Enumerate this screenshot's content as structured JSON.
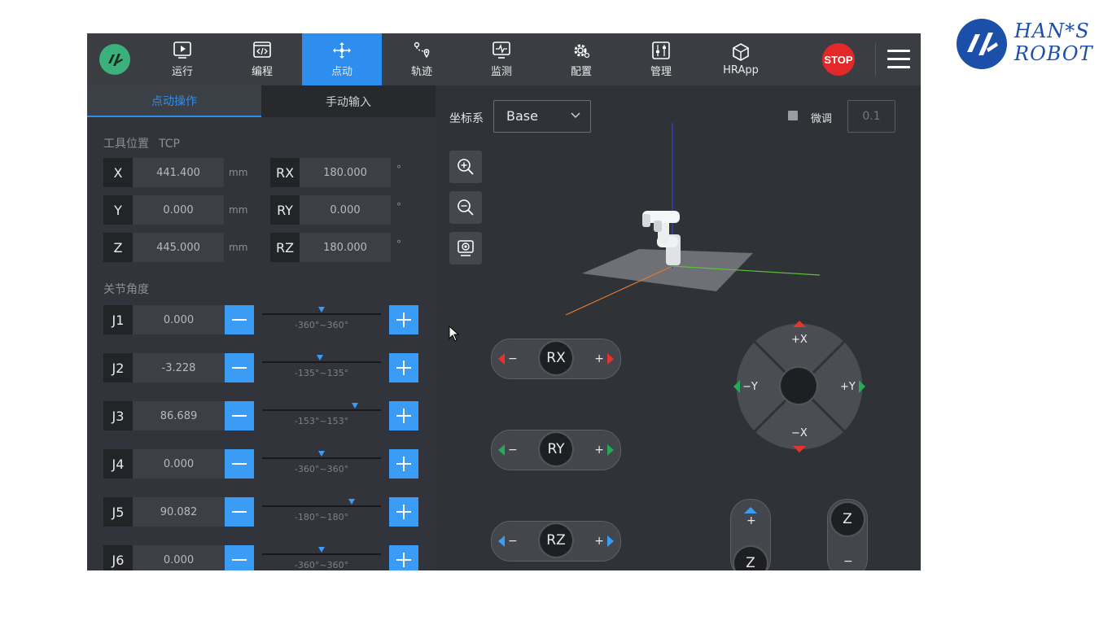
{
  "brand": {
    "line1": "HAN*S",
    "line2": "ROBOT",
    "color": "#1c4fa8"
  },
  "nav": [
    {
      "label": "运行",
      "icon": "play-icon"
    },
    {
      "label": "编程",
      "icon": "code-icon"
    },
    {
      "label": "点动",
      "icon": "move-arrows-icon",
      "active": true
    },
    {
      "label": "轨迹",
      "icon": "trajectory-icon"
    },
    {
      "label": "监测",
      "icon": "monitor-icon"
    },
    {
      "label": "配置",
      "icon": "gear-icon"
    },
    {
      "label": "管理",
      "icon": "sliders-icon"
    },
    {
      "label": "HRApp",
      "icon": "cube-icon"
    }
  ],
  "stop_label": "STOP",
  "tabs": {
    "jog": "点动操作",
    "manual": "手动输入"
  },
  "tool_position": {
    "label": "工具位置",
    "sublabel": "TCP",
    "fields": [
      {
        "name": "X",
        "value": "441.400",
        "unit": "mm"
      },
      {
        "name": "Y",
        "value": "0.000",
        "unit": "mm"
      },
      {
        "name": "Z",
        "value": "445.000",
        "unit": "mm"
      },
      {
        "name": "RX",
        "value": "180.000",
        "unit": "°"
      },
      {
        "name": "RY",
        "value": "0.000",
        "unit": "°"
      },
      {
        "name": "RZ",
        "value": "180.000",
        "unit": "°"
      }
    ]
  },
  "joints": {
    "label": "关节角度",
    "items": [
      {
        "name": "J1",
        "value": "0.000",
        "range": "-360°~360°",
        "min": -360,
        "max": 360,
        "angle": 0.0
      },
      {
        "name": "J2",
        "value": "-3.228",
        "range": "-135°~135°",
        "min": -135,
        "max": 135,
        "angle": -3.228
      },
      {
        "name": "J3",
        "value": "86.689",
        "range": "-153°~153°",
        "min": -153,
        "max": 153,
        "angle": 86.689
      },
      {
        "name": "J4",
        "value": "0.000",
        "range": "-360°~360°",
        "min": -360,
        "max": 360,
        "angle": 0.0
      },
      {
        "name": "J5",
        "value": "90.082",
        "range": "-180°~180°",
        "min": -180,
        "max": 180,
        "angle": 90.082
      },
      {
        "name": "J6",
        "value": "0.000",
        "range": "-360°~360°",
        "min": -360,
        "max": 360,
        "angle": 0.0
      }
    ]
  },
  "coord_system": {
    "label": "坐标系",
    "value": "Base"
  },
  "fine_tune": {
    "label": "微调",
    "value": "0.1"
  },
  "rotation": [
    {
      "name": "RX",
      "minus": "−",
      "plus": "+",
      "color": "#e8332c"
    },
    {
      "name": "RY",
      "minus": "−",
      "plus": "+",
      "color": "#26a95a"
    },
    {
      "name": "RZ",
      "minus": "−",
      "plus": "+",
      "color": "#3a9cf5"
    }
  ],
  "dpad": {
    "up": "+X",
    "down": "−X",
    "left": "−Y",
    "right": "+Y"
  },
  "z_buttons": {
    "up_plus": "+",
    "up_label": "Z",
    "down_label": "Z",
    "down_minus": "−"
  },
  "colors": {
    "accent": "#2d8ef0",
    "stop": "#e3282a"
  }
}
